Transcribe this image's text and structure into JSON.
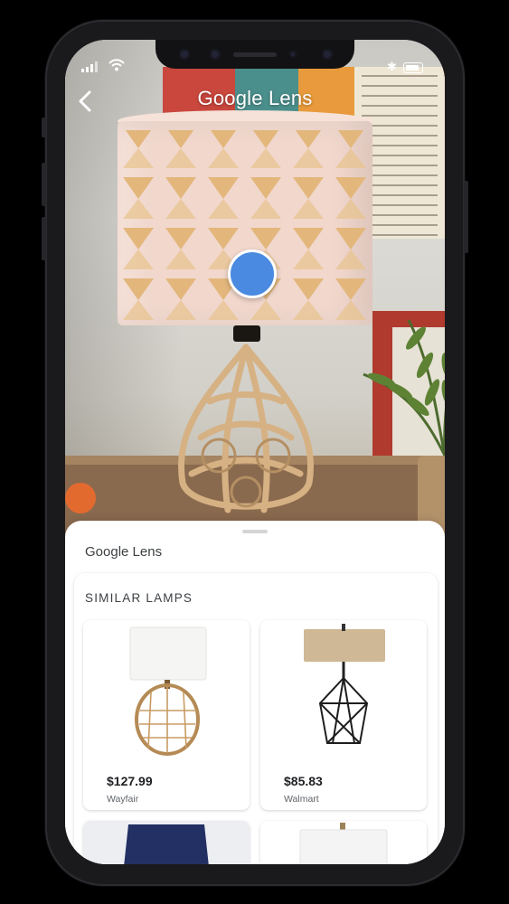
{
  "app": {
    "title": "Google Lens",
    "back_icon": "arrow-back-icon"
  },
  "status_bar": {
    "icons": [
      "signal-icon",
      "wifi-icon",
      "bluetooth-icon",
      "battery-icon"
    ]
  },
  "sheet": {
    "brand": "Google Lens",
    "section_title": "SIMILAR LAMPS",
    "products": [
      {
        "price": "$127.99",
        "store": "Wayfair",
        "image": "rattan-lamp-white-shade"
      },
      {
        "price": "$85.83",
        "store": "Walmart",
        "image": "wire-cage-lamp-linen-shade"
      },
      {
        "price": "",
        "store": "",
        "image": "navy-shade-lamp"
      },
      {
        "price": "",
        "store": "",
        "image": "white-shade-lamp"
      }
    ]
  },
  "colors": {
    "accent_dot": "#4a8ae0",
    "sheet_bg": "#ffffff"
  }
}
